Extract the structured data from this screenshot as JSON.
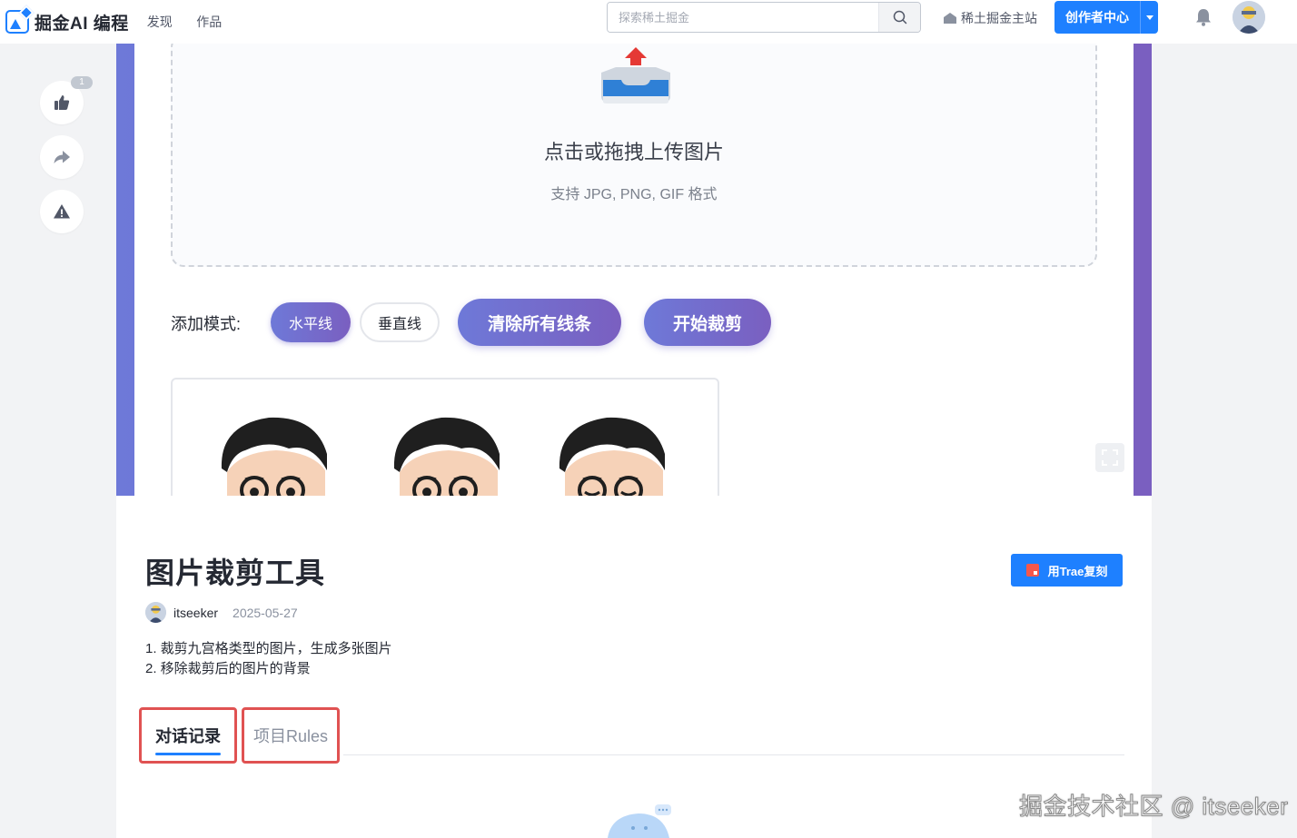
{
  "header": {
    "logo_text": "掘金AI 编程",
    "nav": [
      "发现",
      "作品"
    ],
    "search_placeholder": "探索稀土掘金",
    "home_link": "稀土掘金主站",
    "creator_button": "创作者中心"
  },
  "side_actions": {
    "like_count": "1"
  },
  "preview": {
    "upload_title": "点击或拖拽上传图片",
    "upload_hint": "支持 JPG, PNG, GIF 格式",
    "mode_label": "添加模式:",
    "mode_horizontal": "水平线",
    "mode_vertical": "垂直线",
    "clear_button": "清除所有线条",
    "crop_button": "开始裁剪"
  },
  "project": {
    "title": "图片裁剪工具",
    "copy_button": "用Trae复刻",
    "author": "itseeker",
    "date": "2025-05-27",
    "description": [
      "1. 裁剪九宫格类型的图片，生成多张图片",
      "2. 移除裁剪后的图片的背景"
    ],
    "tabs": [
      "对话记录",
      "项目Rules"
    ]
  },
  "watermark": "掘金技术社区 @ itseeker",
  "colors": {
    "accent": "#1e80ff",
    "gradient_start": "#6e79d8",
    "gradient_end": "#7a5fc0",
    "tab_outline": "#e05252"
  }
}
